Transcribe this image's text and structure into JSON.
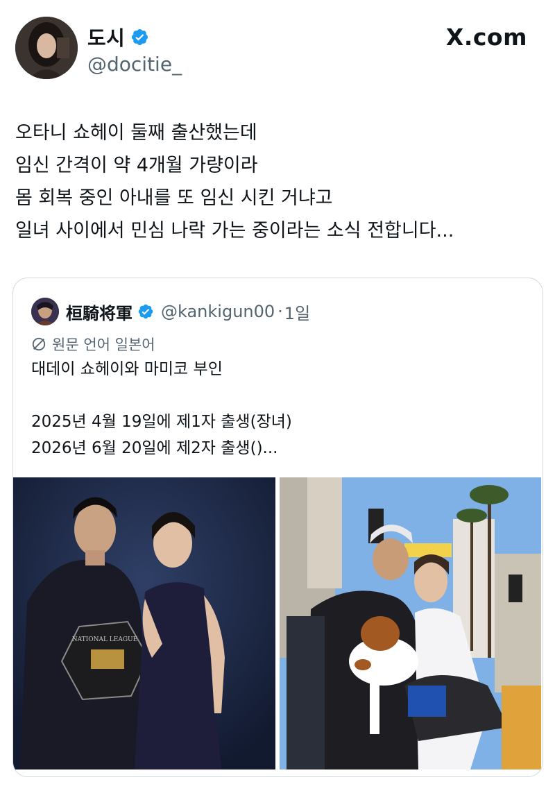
{
  "header": {
    "display_name": "도시",
    "handle": "@docitie_",
    "site_label": "X.com",
    "avatar_icon": "avatar-photo",
    "verified_icon": "verified-badge-icon",
    "accent_color": "#1d9bf0"
  },
  "tweet": {
    "lines": [
      "오타니 쇼헤이 둘째 출산했는데",
      "임신 간격이 약 4개월 가량이라",
      "몸 회복 중인 아내를 또 임신 시킨 거냐고",
      "일녀 사이에서 민심 나락 가는 중이라는 소식 전합니다..."
    ]
  },
  "quote": {
    "display_name": "桓騎将軍",
    "handle": "@kankigun00",
    "separator": "·",
    "date": "1일",
    "translate_label": "원문 언어 일본어",
    "lines": [
      "대데이 쇼헤이와 마미코 부인",
      "",
      "2025년 4월 19일에 제1자 출생(장녀)",
      "2026년 6월 20일에 제2자 출생()..."
    ],
    "photos": [
      {
        "label": "award-ceremony-photo"
      },
      {
        "label": "parade-with-dog-photo"
      }
    ],
    "award_plaque_text": "NATIONAL LEAGUE"
  }
}
